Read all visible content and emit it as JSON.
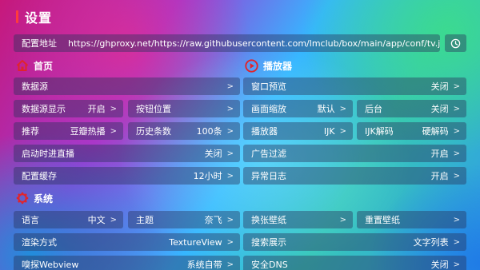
{
  "header": {
    "title": "设置"
  },
  "config": {
    "label": "配置地址",
    "url": "https://ghproxy.net/https://raw.githubusercontent.com/lmclub/box/main/app/conf/tv.json"
  },
  "sections": {
    "home": "首页",
    "player": "播放器",
    "system": "系统"
  },
  "home": {
    "data_source": {
      "label": "数据源",
      "value": ""
    },
    "data_source_display": {
      "label": "数据源显示",
      "value": "开启"
    },
    "button_position": {
      "label": "按钮位置",
      "value": ""
    },
    "recommend": {
      "label": "推荐",
      "value": "豆瓣热播"
    },
    "history_count": {
      "label": "历史条数",
      "value": "100条"
    },
    "startup_live": {
      "label": "启动时进直播",
      "value": "关闭"
    },
    "config_cache": {
      "label": "配置缓存",
      "value": "12小时"
    }
  },
  "player": {
    "window_preview": {
      "label": "窗口预览",
      "value": "关闭"
    },
    "scale": {
      "label": "画面缩放",
      "value": "默认"
    },
    "background": {
      "label": "后台",
      "value": "关闭"
    },
    "player": {
      "label": "播放器",
      "value": "IJK"
    },
    "ijk_decode": {
      "label": "IJK解码",
      "value": "硬解码"
    },
    "ad_filter": {
      "label": "广告过滤",
      "value": "开启"
    },
    "error_log": {
      "label": "异常日志",
      "value": "开启"
    }
  },
  "system": {
    "language": {
      "label": "语言",
      "value": "中文"
    },
    "theme": {
      "label": "主题",
      "value": "奈飞"
    },
    "switch_wallpaper": {
      "label": "换张壁纸",
      "value": ""
    },
    "reset_wallpaper": {
      "label": "重置壁纸",
      "value": ""
    },
    "render_mode": {
      "label": "渲染方式",
      "value": "TextureView"
    },
    "search_display": {
      "label": "搜索展示",
      "value": "文字列表"
    },
    "sniff_webview": {
      "label": "嗅探Webview",
      "value": "系统自带"
    },
    "secure_dns": {
      "label": "安全DNS",
      "value": "关闭"
    }
  },
  "chevron": ">",
  "icons": {
    "home": "home-icon",
    "player": "play-circle-icon",
    "system": "gear-icon",
    "history": "history-icon"
  },
  "colors": {
    "accent": "#e0242c",
    "title_bar": "#ff3b3b"
  }
}
